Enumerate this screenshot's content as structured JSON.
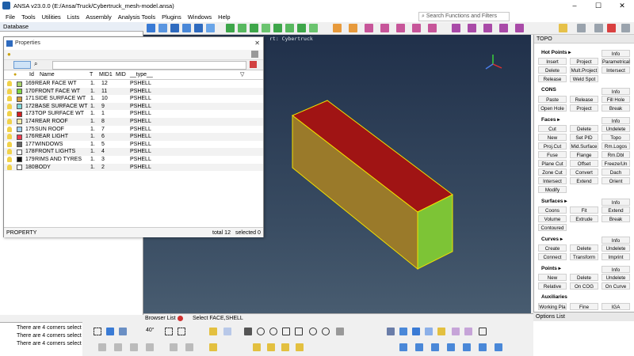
{
  "window": {
    "title": "ANSA v23.0.0 (E:/Ansa/Truck/Cybertruck_mesh-model.ansa)"
  },
  "menu": [
    "File",
    "Tools",
    "Utilities",
    "Lists",
    "Assembly",
    "Analysis Tools",
    "Plugins",
    "Windows",
    "Help"
  ],
  "search": {
    "placeholder": "Search Functions and Filters"
  },
  "database": {
    "title": "Database"
  },
  "viewport": {
    "label": "rt: Cybertruck"
  },
  "properties": {
    "title": "Properties",
    "columns": [
      "Id",
      "Name",
      "T",
      "MID1",
      "MID",
      "__type__"
    ],
    "rows": [
      {
        "id": "169",
        "name": "REAR FACE WT",
        "t": "1.",
        "mid1": "12",
        "type": "PSHELL",
        "color": "#a8d26a"
      },
      {
        "id": "170",
        "name": "FRONT FACE WT",
        "t": "1.",
        "mid1": "11",
        "type": "PSHELL",
        "color": "#7fd640"
      },
      {
        "id": "171",
        "name": "SIDE SURFACE WT",
        "t": "1.",
        "mid1": "10",
        "type": "PSHELL",
        "color": "#d29b3c"
      },
      {
        "id": "172",
        "name": "BASE SURFACE WT",
        "t": "1.",
        "mid1": "9",
        "type": "PSHELL",
        "color": "#7fd6d6"
      },
      {
        "id": "173",
        "name": "TOP SURFACE WT",
        "t": "1.",
        "mid1": "1",
        "type": "PSHELL",
        "color": "#d42020"
      },
      {
        "id": "174",
        "name": "REAR ROOF",
        "t": "1.",
        "mid1": "8",
        "type": "PSHELL",
        "color": "#f2eaa8"
      },
      {
        "id": "175",
        "name": "SUN ROOF",
        "t": "1.",
        "mid1": "7",
        "type": "PSHELL",
        "color": "#9fd0ee"
      },
      {
        "id": "176",
        "name": "REAR LIGHT",
        "t": "1.",
        "mid1": "6",
        "type": "PSHELL",
        "color": "#ee3c50"
      },
      {
        "id": "177",
        "name": "WINDOWS",
        "t": "1.",
        "mid1": "5",
        "type": "PSHELL",
        "color": "#646464"
      },
      {
        "id": "178",
        "name": "FRONT LIGHTS",
        "t": "1.",
        "mid1": "4",
        "type": "PSHELL",
        "color": "#ffffff"
      },
      {
        "id": "179",
        "name": "RIMS AND TYRES",
        "t": "1.",
        "mid1": "3",
        "type": "PSHELL",
        "color": "#101010"
      },
      {
        "id": "180",
        "name": "BODY",
        "t": "1.",
        "mid1": "2",
        "type": "PSHELL",
        "color": "#ffffff"
      }
    ],
    "status": {
      "left": "PROPERTY",
      "total": "total 12",
      "selected": "selected 0"
    }
  },
  "topo": {
    "title": "TOPO",
    "sections": [
      {
        "label": "Hot Points ▸",
        "buttons": [
          "Info",
          "Insert",
          "Project",
          "Parametrical",
          "Delete",
          "Mult.Project",
          "Intersect",
          "Release",
          "Weld Spot"
        ]
      },
      {
        "label": "CONS",
        "buttons": [
          "Info",
          "Paste",
          "Release",
          "Fill Hole",
          "Open Hole",
          "Project",
          "Break"
        ]
      },
      {
        "label": "Faces ▸",
        "buttons": [
          "Info",
          "Cut",
          "Delete",
          "Undelete",
          "New",
          "Set PID",
          "Topo",
          "Proj.Cut",
          "Mid.Surface",
          "Rm.Logos",
          "Fuse",
          "Flange",
          "Rm.Dbl",
          "Plane Cut",
          "Offset",
          "Freeze/Un",
          "Zone Cut",
          "Convert",
          "Dach",
          "Intersect",
          "Extend",
          "Orient",
          "Modify"
        ]
      },
      {
        "label": "Surfaces ▸",
        "buttons": [
          "Info",
          "Coons",
          "Fit",
          "Extend",
          "Volume",
          "Extrude",
          "Break",
          "Contoured"
        ]
      },
      {
        "label": "Curves ▸",
        "buttons": [
          "Info",
          "Create",
          "Delete",
          "Undelete",
          "Connect",
          "Transform",
          "Imprint"
        ]
      },
      {
        "label": "Points ▸",
        "buttons": [
          "Info",
          "New",
          "Delete",
          "Undelete",
          "Relative",
          "On COG",
          "On Curve"
        ]
      },
      {
        "label": "Auxiliaries",
        "buttons": [
          "Working Pla",
          "Fine",
          "IGA"
        ]
      }
    ]
  },
  "options_list": {
    "title": "Options List"
  },
  "bottom": {
    "browser_list": "Browser List",
    "select_mode": "Select FACE,SHELL",
    "angle": "40°"
  },
  "messages": [
    "There are 4 corners select",
    "There are 4 corners select",
    "There are 4 corners select"
  ]
}
